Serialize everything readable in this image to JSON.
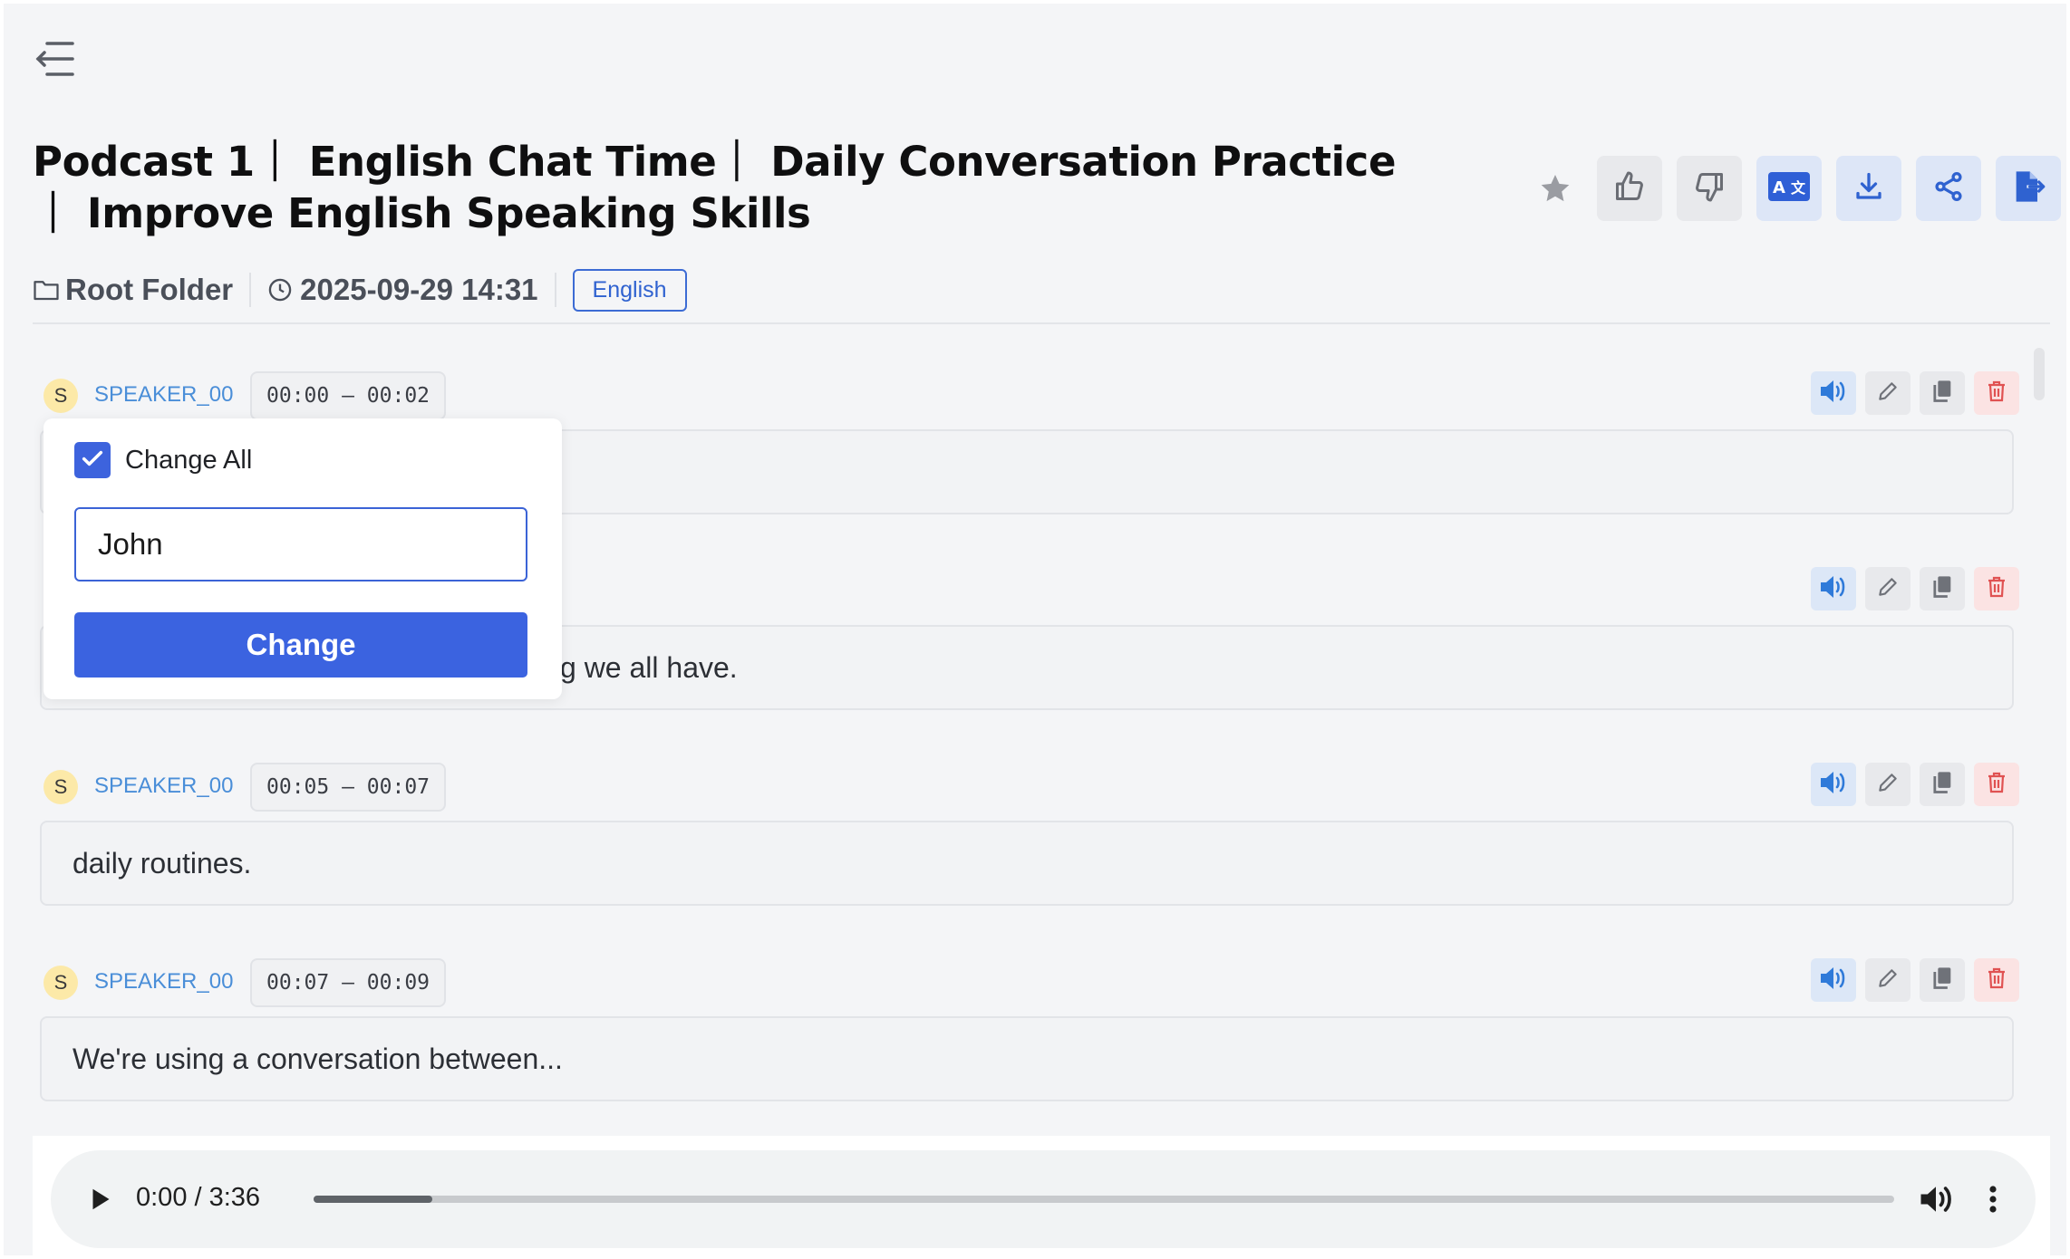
{
  "title": "Podcast 1｜ English Chat Time｜ Daily Conversation Practice ｜ Improve English Speaking Skills",
  "meta": {
    "folder_icon": "folder-icon",
    "folder": "Root Folder",
    "clock_icon": "clock-icon",
    "datetime": "2025-09-29 14:31",
    "language": "English"
  },
  "toolbar": {
    "icons": [
      "star-icon",
      "thumbs-up-icon",
      "thumbs-down-icon",
      "translate-icon",
      "download-icon",
      "share-icon",
      "export-icon"
    ]
  },
  "segments": [
    {
      "avatar": "S",
      "speaker": "SPEAKER_00",
      "time": "00:00 – 00:02",
      "text": ""
    },
    {
      "avatar": "S",
      "speaker": "SPEAKER_00",
      "time": "",
      "text": "g we all have."
    },
    {
      "avatar": "S",
      "speaker": "SPEAKER_00",
      "time": "00:05 – 00:07",
      "text": "daily routines."
    },
    {
      "avatar": "S",
      "speaker": "SPEAKER_00",
      "time": "00:07 – 00:09",
      "text": "We're using a conversation between..."
    }
  ],
  "rename_popup": {
    "change_all_label": "Change All",
    "change_all_checked": true,
    "input_value": "John",
    "button_label": "Change"
  },
  "player": {
    "time": "0:00 / 3:36",
    "progress_buffered_fraction": 0.075
  },
  "colors": {
    "accent": "#3b63e0",
    "speaker_link": "#4a8ed8",
    "delete": "#e05252"
  }
}
